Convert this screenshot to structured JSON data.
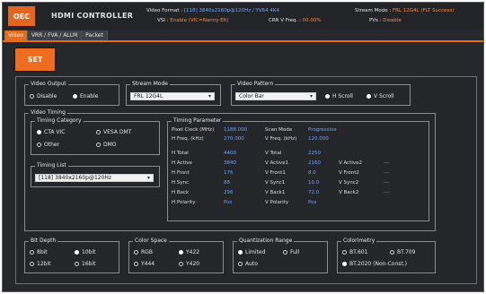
{
  "topbar": {
    "logo": "OEC",
    "title": "HDMI CONTROLLER",
    "video_format_label": "Video Format :",
    "video_format_value": "[118] 3840x2160p@120Hz / YV64 4K4",
    "vsi_label": "VSI :",
    "vsi_value": "Enable (VIC=Nanny-Elt)",
    "crr_label": "CRR V Freq. :",
    "crr_value": "00.00%",
    "stream_mode_label": "Stream Mode :",
    "stream_mode_value": "FRL 12G4L (FLT Success)",
    "pcs_label": "PVs :",
    "pcs_value": "Disable"
  },
  "tabs": [
    "Video",
    "VRR / FVA / ALLM",
    "Packet"
  ],
  "set_button": "SET",
  "video_output": {
    "legend": "Video Output",
    "options": [
      "Disable",
      "Enable"
    ]
  },
  "stream_mode": {
    "legend": "Stream Mode",
    "value": "FRL 12G4L"
  },
  "video_pattern": {
    "legend": "Video Pattern",
    "value": "Color Bar",
    "options": [
      "H Scroll",
      "V Scroll"
    ]
  },
  "video_timing": {
    "legend": "Video Timing",
    "category_legend": "Timing Category",
    "categories": [
      "CTA VIC",
      "VESA DMT",
      "Other",
      "DMO"
    ],
    "list_legend": "Timing List",
    "list_value": "[118] 3840x2160p@120Hz"
  },
  "timing_params": {
    "legend": "Timing Parameter",
    "pixel_clock_label": "Pixel Clock (MHz)",
    "pixel_clock_value": "1188.000",
    "scan_mode_label": "Scan Mode",
    "scan_mode_value": "Progressive",
    "hfreq_label": "H Freq. (kHz)",
    "hfreq_value": "270.000",
    "vfreq_label": "V Freq. (kHz)",
    "vfreq_value": "120.000",
    "rows": [
      {
        "h_label": "H Total",
        "h_value": "4400",
        "v_label": "V Total",
        "v_value": "2250",
        "v2_label": "",
        "v2_value": "",
        "dash": ""
      },
      {
        "h_label": "H Active",
        "h_value": "3840",
        "v_label": "V Active1",
        "v_value": "2160",
        "v2_label": "V Active2",
        "v2_value": "",
        "dash": "---"
      },
      {
        "h_label": "H Front",
        "h_value": "176",
        "v_label": "V Front1",
        "v_value": "8.0",
        "v2_label": "V Front2",
        "v2_value": "",
        "dash": "---"
      },
      {
        "h_label": "H Sync",
        "h_value": "88",
        "v_label": "V Sync1",
        "v_value": "10.0",
        "v2_label": "V Sync2",
        "v2_value": "",
        "dash": "---"
      },
      {
        "h_label": "H Back",
        "h_value": "296",
        "v_label": "V Back1",
        "v_value": "72.0",
        "v2_label": "V Back2",
        "v2_value": "",
        "dash": "---"
      },
      {
        "h_label": "H Polarity",
        "h_value": "Pos",
        "v_label": "V Polarity",
        "v_value": "Pos",
        "v2_label": "",
        "v2_value": "",
        "dash": ""
      }
    ]
  },
  "bit_depth": {
    "legend": "Bit Depth",
    "options": [
      "8bit",
      "10bit",
      "12bit",
      "16bit"
    ]
  },
  "color_space": {
    "legend": "Color Space",
    "options": [
      "RGB",
      "Y422",
      "Y444",
      "Y420"
    ]
  },
  "quantization": {
    "legend": "Quantization Range",
    "options": [
      "Limited",
      "Full",
      "Auto"
    ]
  },
  "colorimetry": {
    "legend": "Colorimetry",
    "options": [
      "BT.601",
      "BT.709",
      "BT.2020 (Non-Const.)"
    ]
  },
  "colors": {
    "accent": "#e56b1f",
    "value_blue": "#6fa0ff",
    "background": "#26282c"
  }
}
